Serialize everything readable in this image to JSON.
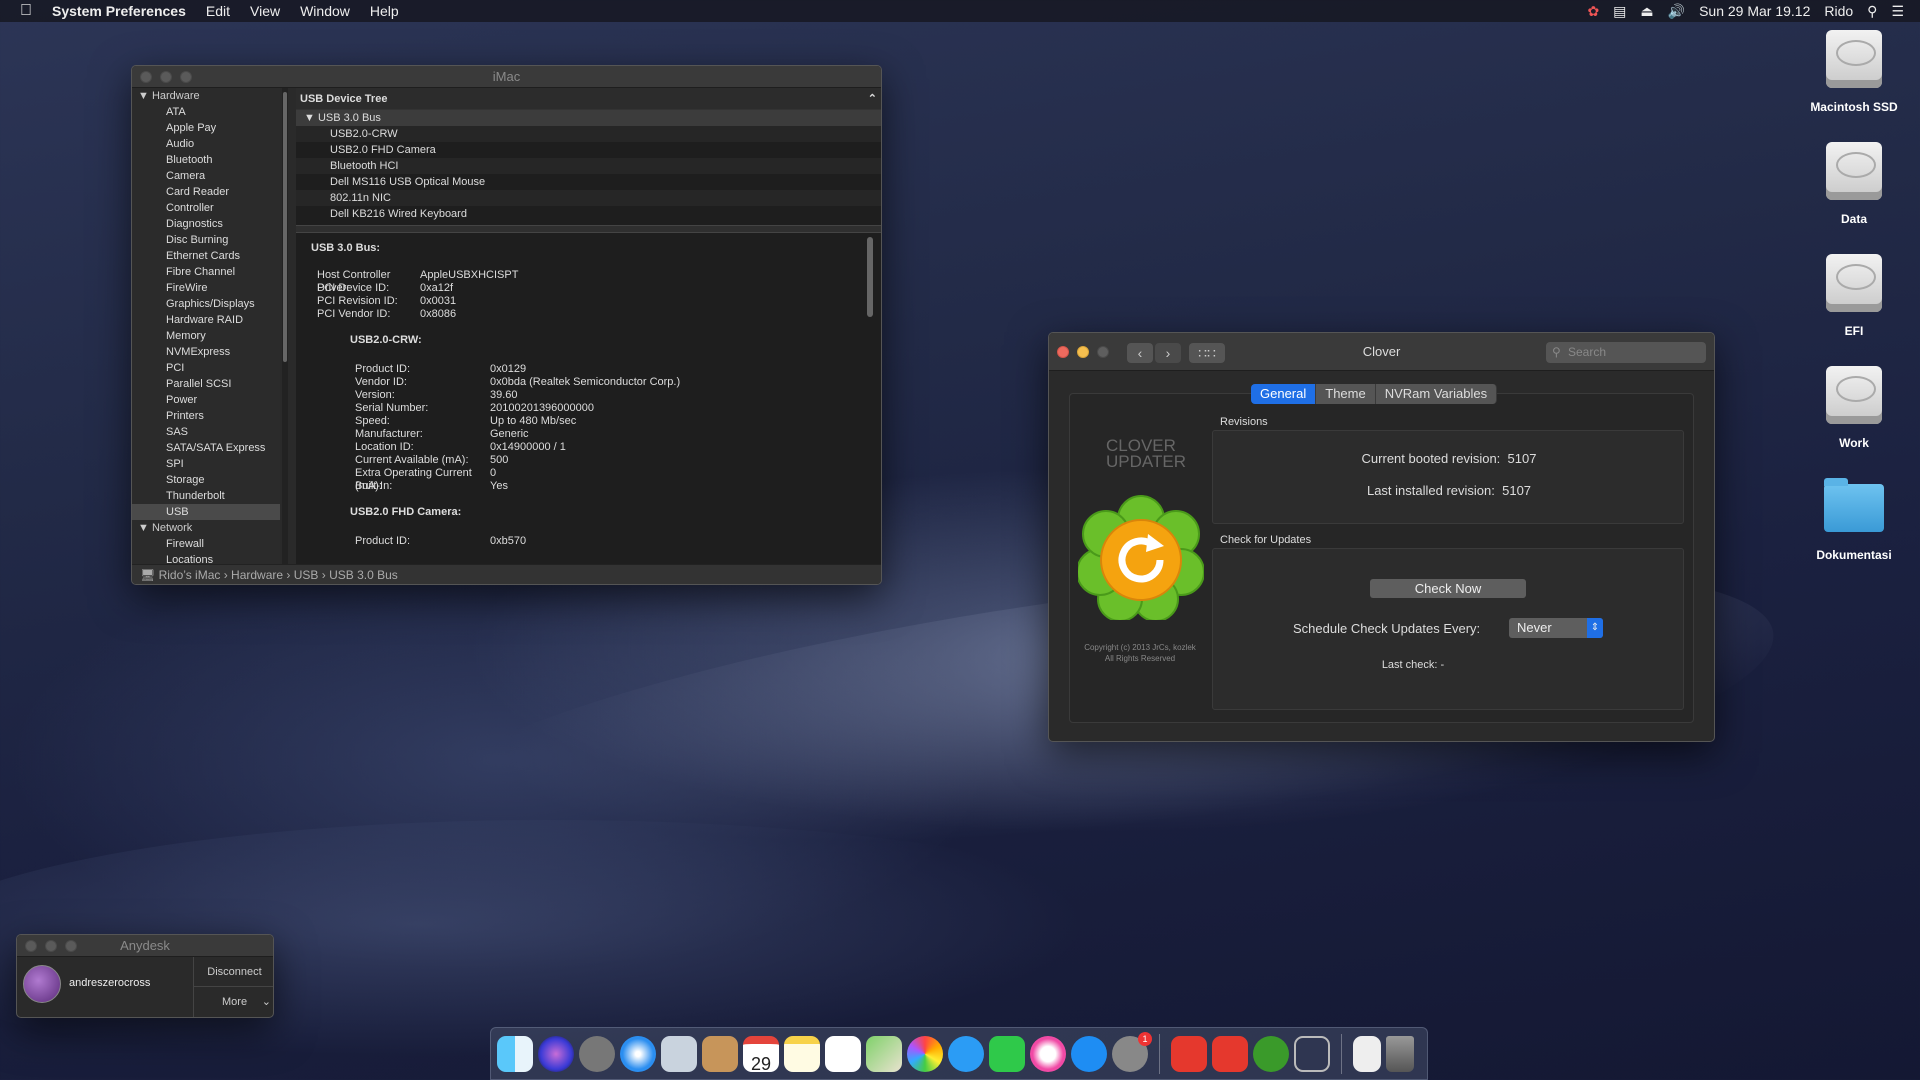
{
  "menubar": {
    "app": "System Preferences",
    "items": [
      "Edit",
      "View",
      "Window",
      "Help"
    ],
    "clock": "Sun 29 Mar 19.12",
    "user": "Rido"
  },
  "sysinfo": {
    "title": "iMac",
    "sidebar": {
      "hardware_header": "Hardware",
      "hardware_items": [
        "ATA",
        "Apple Pay",
        "Audio",
        "Bluetooth",
        "Camera",
        "Card Reader",
        "Controller",
        "Diagnostics",
        "Disc Burning",
        "Ethernet Cards",
        "Fibre Channel",
        "FireWire",
        "Graphics/Displays",
        "Hardware RAID",
        "Memory",
        "NVMExpress",
        "PCI",
        "Parallel SCSI",
        "Power",
        "Printers",
        "SAS",
        "SATA/SATA Express",
        "SPI",
        "Storage",
        "Thunderbolt",
        "USB"
      ],
      "selected": "USB",
      "network_header": "Network",
      "network_items": [
        "Firewall",
        "Locations"
      ]
    },
    "tree": {
      "header": "USB Device Tree",
      "bus": "USB 3.0 Bus",
      "devices": [
        "USB2.0-CRW",
        "USB2.0 FHD Camera",
        "Bluetooth HCI",
        "Dell MS116 USB Optical Mouse",
        "802.11n NIC",
        "Dell KB216 Wired Keyboard"
      ]
    },
    "detail": {
      "bus_title": "USB 3.0 Bus:",
      "bus_props": [
        [
          "Host Controller Driver:",
          "AppleUSBXHCISPT"
        ],
        [
          "PCI Device ID:",
          "0xa12f"
        ],
        [
          "PCI Revision ID:",
          "0x0031"
        ],
        [
          "PCI Vendor ID:",
          "0x8086"
        ]
      ],
      "dev1_title": "USB2.0-CRW:",
      "dev1_props": [
        [
          "Product ID:",
          "0x0129"
        ],
        [
          "Vendor ID:",
          "0x0bda  (Realtek Semiconductor Corp.)"
        ],
        [
          "Version:",
          "39.60"
        ],
        [
          "Serial Number:",
          "20100201396000000"
        ],
        [
          "Speed:",
          "Up to 480 Mb/sec"
        ],
        [
          "Manufacturer:",
          "Generic"
        ],
        [
          "Location ID:",
          "0x14900000 / 1"
        ],
        [
          "Current Available (mA):",
          "500"
        ],
        [
          "Extra Operating Current (mA):",
          "0"
        ],
        [
          "Built-In:",
          "Yes"
        ]
      ],
      "dev2_title": "USB2.0 FHD Camera:",
      "dev2_props": [
        [
          "Product ID:",
          "0xb570"
        ]
      ]
    },
    "path": "Rido’s iMac › Hardware › USB › USB 3.0 Bus"
  },
  "clover": {
    "title": "Clover",
    "search_placeholder": "Search",
    "tabs": [
      "General",
      "Theme",
      "NVRam Variables"
    ],
    "logo_line1": "CLOVER",
    "logo_line2": "UPDATER",
    "copyright_line1": "Copyright (c) 2013 JrCs, kozlek",
    "copyright_line2": "All Rights Reserved",
    "revisions_label": "Revisions",
    "booted_label": "Current booted revision:",
    "booted_value": "5107",
    "installed_label": "Last installed revision:",
    "installed_value": "5107",
    "updates_label": "Check for Updates",
    "check_now": "Check Now",
    "schedule_label": "Schedule Check Updates Every:",
    "schedule_value": "Never",
    "last_check": "Last check: -"
  },
  "desktop": [
    "Macintosh SSD",
    "Data",
    "EFI",
    "Work",
    "Dokumentasi"
  ],
  "anydesk": {
    "title": "Anydesk",
    "user": "andreszerocross",
    "disconnect": "Disconnect",
    "more": "More"
  },
  "dock": {
    "calendar_day": "29",
    "badge": "1"
  }
}
